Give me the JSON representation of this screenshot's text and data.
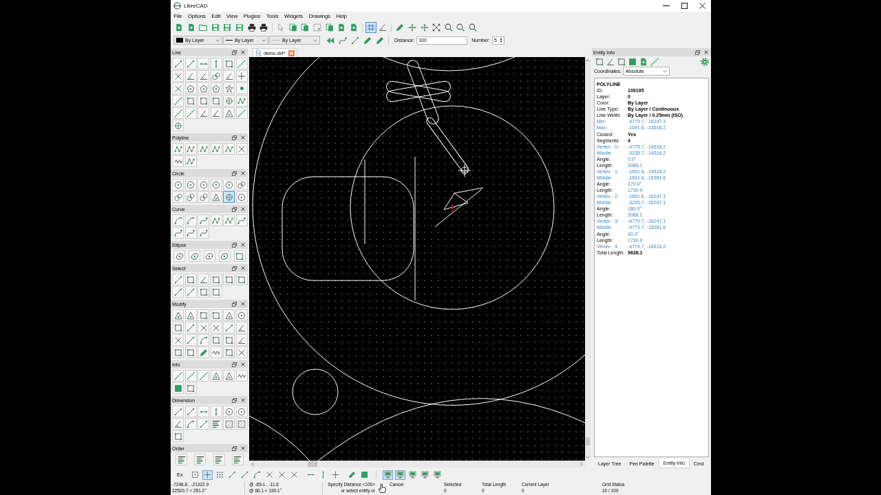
{
  "window": {
    "title": "LibreCAD"
  },
  "menu": [
    "File",
    "Options",
    "Edit",
    "View",
    "Plugins",
    "Tools",
    "Widgets",
    "Drawings",
    "Help"
  ],
  "toolbar": {
    "grid_on": true
  },
  "pen_toolbar": {
    "combos": [
      "By Layer",
      "By Layer",
      "By Layer"
    ],
    "distance_label": "Distance:",
    "distance": "100",
    "number_label": "Number:",
    "number": "5"
  },
  "tool_palettes": [
    {
      "title": "Line",
      "tools": [
        {
          "selected": false
        },
        {
          "selected": false
        },
        {
          "selected": false
        },
        {
          "selected": false
        },
        {
          "selected": false
        },
        {
          "selected": false
        },
        {
          "selected": false
        },
        {
          "selected": false
        },
        {
          "selected": false
        },
        {
          "selected": false
        },
        {
          "selected": false
        },
        {
          "selected": false
        },
        {
          "selected": false
        },
        {
          "selected": false
        },
        {
          "selected": false
        },
        {
          "selected": false
        },
        {
          "selected": false
        },
        {
          "selected": false
        },
        {
          "selected": false
        },
        {
          "selected": false
        },
        {
          "selected": false
        },
        {
          "selected": false
        },
        {
          "selected": false
        },
        {
          "selected": false
        },
        {
          "selected": false
        },
        {
          "selected": false
        },
        {
          "selected": false
        },
        {
          "selected": false
        },
        {
          "selected": false
        },
        {
          "selected": false
        },
        {
          "selected": false
        }
      ]
    },
    {
      "title": "Polyline",
      "tools": [
        {
          "selected": false
        },
        {
          "selected": false
        },
        {
          "selected": false
        },
        {
          "selected": false
        },
        {
          "selected": false
        },
        {
          "selected": false
        },
        {
          "selected": false
        },
        {
          "selected": false
        }
      ]
    },
    {
      "title": "Circle",
      "tools": [
        {
          "selected": false
        },
        {
          "selected": false
        },
        {
          "selected": false
        },
        {
          "selected": false
        },
        {
          "selected": false
        },
        {
          "selected": false
        },
        {
          "selected": false
        },
        {
          "selected": false
        },
        {
          "selected": false
        },
        {
          "selected": false
        },
        {
          "selected": true
        },
        {
          "selected": false
        }
      ]
    },
    {
      "title": "Curve",
      "tools": [
        {
          "selected": false
        },
        {
          "selected": false
        },
        {
          "selected": false
        },
        {
          "selected": false
        },
        {
          "selected": false
        },
        {
          "selected": false
        },
        {
          "selected": false
        },
        {
          "selected": false
        },
        {
          "selected": false
        }
      ]
    },
    {
      "title": "Ellipse",
      "tools": [
        {
          "selected": false
        },
        {
          "selected": false
        },
        {
          "selected": false
        },
        {
          "selected": false
        },
        {
          "selected": false
        }
      ]
    },
    {
      "title": "Select",
      "tools": [
        {
          "selected": false
        },
        {
          "selected": false
        },
        {
          "selected": false
        },
        {
          "selected": false
        },
        {
          "selected": false
        },
        {
          "selected": false
        },
        {
          "selected": false
        },
        {
          "selected": false
        },
        {
          "selected": false
        },
        {
          "selected": false
        }
      ]
    },
    {
      "title": "Modify",
      "tools": [
        {
          "selected": false
        },
        {
          "selected": false
        },
        {
          "selected": false
        },
        {
          "selected": false
        },
        {
          "selected": false
        },
        {
          "selected": false
        },
        {
          "selected": false
        },
        {
          "selected": false
        },
        {
          "selected": false
        },
        {
          "selected": false
        },
        {
          "selected": false
        },
        {
          "selected": false
        },
        {
          "selected": false
        },
        {
          "selected": false
        },
        {
          "selected": false
        },
        {
          "selected": false
        },
        {
          "selected": false
        },
        {
          "selected": false
        },
        {
          "selected": false
        },
        {
          "selected": false
        },
        {
          "selected": false
        },
        {
          "selected": false
        },
        {
          "selected": false
        },
        {
          "selected": false
        }
      ]
    },
    {
      "title": "Info",
      "tools": [
        {
          "selected": false
        },
        {
          "selected": false
        },
        {
          "selected": false
        },
        {
          "selected": false
        },
        {
          "selected": false
        },
        {
          "selected": false
        },
        {
          "selected": false
        },
        {
          "selected": false
        }
      ]
    },
    {
      "title": "Dimension",
      "tools": [
        {
          "selected": false
        },
        {
          "selected": false
        },
        {
          "selected": false
        },
        {
          "selected": false
        },
        {
          "selected": false
        },
        {
          "selected": false
        },
        {
          "selected": false
        },
        {
          "selected": false
        },
        {
          "selected": false
        },
        {
          "selected": false
        },
        {
          "selected": false
        },
        {
          "selected": false
        },
        {
          "selected": false
        }
      ]
    },
    {
      "title": "Order",
      "tools": [
        {
          "selected": false
        },
        {
          "selected": false
        },
        {
          "selected": false
        },
        {
          "selected": false
        }
      ]
    }
  ],
  "document_tab": {
    "title": "demo.dxf*"
  },
  "entity_info": {
    "title": "Entity Info",
    "coordinates_label": "Coordinates:",
    "coordinates": "Absolute",
    "entity_type": "POLYLINE",
    "rows": [
      {
        "label": "ID:",
        "value": "109195",
        "kind": "property"
      },
      {
        "label": "Layer:",
        "value": "0",
        "kind": "property"
      },
      {
        "label": "Color:",
        "value": "By Layer",
        "kind": "property"
      },
      {
        "label": "Line Type:",
        "value": "By Layer / Continuous",
        "kind": "property"
      },
      {
        "label": "Line Width:",
        "value": "By Layer / 0.25mm (ISO)",
        "kind": "property"
      },
      {
        "label": "Min:",
        "value": "-4779.7, -16247.1",
        "kind": "point"
      },
      {
        "label": "Max:",
        "value": "-1691.6, -14516.2",
        "kind": "point"
      },
      {
        "label": "Closed:",
        "value": "Yes",
        "kind": "property"
      },
      {
        "label": "Segments:",
        "value": "4",
        "kind": "property"
      },
      {
        "label": "Vertex - 0::",
        "value": "-4779.7, -14516.2",
        "kind": "point"
      },
      {
        "label": "Middle:",
        "value": "-3235.7, -14516.2",
        "kind": "point"
      },
      {
        "label": "Angle:",
        "value": "0.0°",
        "kind": "measure"
      },
      {
        "label": "Length:",
        "value": "3088.1",
        "kind": "measure"
      },
      {
        "label": "Vertex - 1:",
        "value": "-1691.6, -14516.2",
        "kind": "point"
      },
      {
        "label": "Middle:",
        "value": "-1691.6, -15381.6",
        "kind": "point"
      },
      {
        "label": "Angle:",
        "value": "270.0°",
        "kind": "measure"
      },
      {
        "label": "Length:",
        "value": "1730.9",
        "kind": "measure"
      },
      {
        "label": "Vertex - 2:",
        "value": "-1691.6, -16247.1",
        "kind": "point"
      },
      {
        "label": "Middle:",
        "value": "-3235.7, -16247.1",
        "kind": "point"
      },
      {
        "label": "Angle:",
        "value": "180.0°",
        "kind": "measure"
      },
      {
        "label": "Length:",
        "value": "3088.1",
        "kind": "measure"
      },
      {
        "label": "Vertex - 3:",
        "value": "-4779.7, -16247.1",
        "kind": "point"
      },
      {
        "label": "Middle:",
        "value": "-4779.7, -15381.6",
        "kind": "point"
      },
      {
        "label": "Angle:",
        "value": "90.0°",
        "kind": "measure"
      },
      {
        "label": "Length:",
        "value": "1730.9",
        "kind": "measure"
      },
      {
        "label": "Vertex - 4:",
        "value": "-4779.7, -14516.2",
        "kind": "point"
      },
      {
        "label": "Total Length:",
        "value": "9638.1",
        "kind": "property"
      }
    ]
  },
  "dock_tabs": [
    {
      "label": "Layer Tree",
      "selected": false
    },
    {
      "label": "Pen Palette",
      "selected": false
    },
    {
      "label": "Entity Info",
      "selected": true
    },
    {
      "label": "Cmd",
      "selected": false
    }
  ],
  "snap_toolbar": {
    "label": "Ex",
    "snaps": [
      {
        "selected": false
      },
      {
        "selected": true
      },
      {
        "selected": false
      },
      {
        "selected": false
      },
      {
        "selected": false
      },
      {
        "selected": false
      },
      {
        "selected": false
      },
      {
        "selected": false
      },
      {
        "selected": false
      },
      {
        "selected": false
      },
      {
        "selected": false
      },
      {
        "selected": false
      },
      {
        "selected": false
      },
      {
        "selected": false
      }
    ],
    "views": [
      {
        "selected": true
      },
      {
        "selected": true
      },
      {
        "selected": false
      },
      {
        "selected": false
      },
      {
        "selected": false
      }
    ]
  },
  "status_bar": {
    "absolute": [
      "-7246.8 , -21322.9",
      "22520.7 < 251.2°"
    ],
    "relative": [
      "@ -65.1 , -11.6",
      "@ 66.1 < 190.1°"
    ],
    "prompt": [
      "Specify Distance <100>",
      "or select entity or"
    ],
    "cancel": "Cancel",
    "fields": [
      {
        "label": "Selected",
        "value": "0"
      },
      {
        "label": "Total Length",
        "value": "0"
      },
      {
        "label": "Current Layer",
        "value": "0"
      },
      {
        "label": "Grid Status",
        "value": "10 / 100"
      }
    ]
  }
}
